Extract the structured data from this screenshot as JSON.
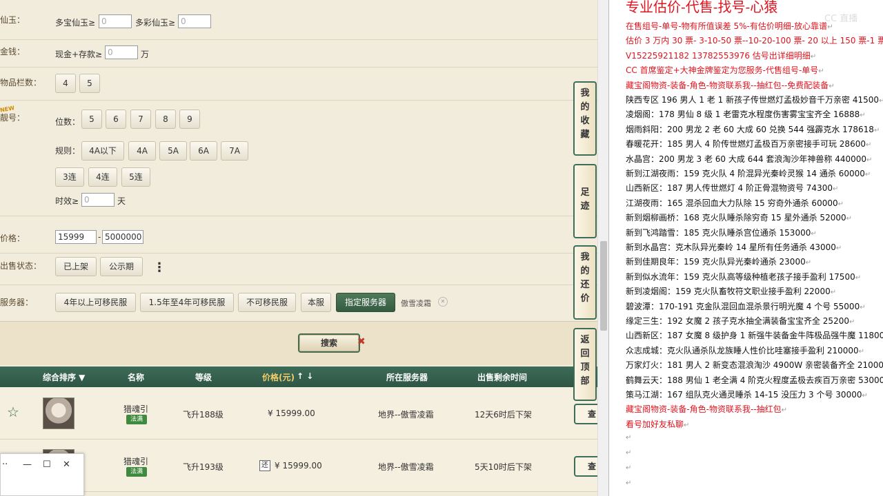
{
  "filters": {
    "jade": {
      "label": "仙玉：",
      "multi_label": "多宝仙玉≥",
      "multi_value": "0",
      "color_label": "多彩仙玉≥",
      "color_value": "0"
    },
    "gold": {
      "label": "金钱：",
      "cash_label": "现金+存款≥",
      "cash_value": "0",
      "unit": "万"
    },
    "slots": {
      "label": "物品栏数：",
      "options": [
        "4",
        "5"
      ]
    },
    "pretty_id": {
      "label": "靓号：",
      "new_badge": "NEW",
      "digits_label": "位数：",
      "digits": [
        "5",
        "6",
        "7",
        "8",
        "9"
      ],
      "rule_label": "规则：",
      "rules": [
        "4A以下",
        "4A",
        "5A",
        "6A",
        "7A"
      ],
      "sequence": [
        "3连",
        "4连",
        "5连"
      ],
      "validity_label": "时效≥",
      "validity_value": "0",
      "validity_unit": "天"
    },
    "price": {
      "label": "价格：",
      "min": "15999",
      "separator": "-",
      "max": "5000000"
    },
    "sale_status": {
      "label": "出售状态：",
      "options": [
        "已上架",
        "公示期"
      ],
      "more": "⋮"
    },
    "server": {
      "label": "服务器：",
      "options": [
        "4年以上可移民服",
        "1.5年至4年可移民服",
        "不可移民服",
        "本服",
        "指定服务器"
      ],
      "active": "指定服务器",
      "selected_server": "傲雪凌霜",
      "clear": "✕"
    }
  },
  "search": {
    "label": "搜索",
    "close": "✖"
  },
  "table": {
    "headers": {
      "sort": "综合排序 ▼",
      "name": "名称",
      "level": "等级",
      "price": "价格(元)",
      "price_arrows": "↑ ↓",
      "server": "所在服务器",
      "time": "出售剩余时间"
    },
    "rows": [
      {
        "star": "☆",
        "name": "猎魂引",
        "school": "法满",
        "level": "飞升188级",
        "return_badge": "",
        "price": "¥ 15999.00",
        "server": "地界--傲雪凌霜",
        "time": "12天6时后下架",
        "view": "查"
      },
      {
        "star": "☆",
        "name": "猎魂引",
        "school": "法满",
        "level": "飞升193级",
        "return_badge": "还",
        "price": "¥ 15999.00",
        "server": "地界--傲雪凌霜",
        "time": "5天10时后下架",
        "view": "查"
      }
    ]
  },
  "side_bar": {
    "favorites": "我的收藏",
    "history": "足迹",
    "bargain": "我的还价",
    "top": "返回顶部"
  },
  "mini_window": {
    "menu": "··",
    "minimize": "—",
    "maximize": "☐",
    "close": "✕"
  },
  "notes": {
    "title": "专业估价-代售-找号-心猿",
    "watermark": "CC 直播",
    "para_mark": "↵",
    "lines": [
      {
        "text": "在售组号-单号-物有所值误差 5%-有估价明细-放心靠谱",
        "color": "red"
      },
      {
        "text": "估价 3 万内 30 票- 3-10-50 票--10-20-100 票- 20 以上 150 票-1 票 1 元",
        "color": "red"
      },
      {
        "text": "V15225921182     13782553976    估号出详细明细",
        "color": "red"
      },
      {
        "text": "CC 首席鉴定+大神金牌鉴定为您服务-代售组号-单号",
        "color": "red"
      },
      {
        "text": "藏宝阁物资-装备-角色-物资联系我--抽红包--免费配装备",
        "color": "red"
      },
      {
        "text": "陕西专区 196 男人 1 老 1 新孩子传世燃灯孟极妙音千万亲密 41500",
        "color": "black"
      },
      {
        "text": "凌烟阁：178 男仙 8 级 1 老雷克水程度伤害雾宝宝齐全 16888",
        "color": "black"
      },
      {
        "text": "烟雨斜阳：200 男龙 2 老 60 大成 60 兑换 544 强霹克水 178618",
        "color": "black"
      },
      {
        "text": "春暖花开：185 男人 4 阶传世燃灯孟极百万亲密接手可玩 28600",
        "color": "black"
      },
      {
        "text": "水晶宫：200 男龙 3 老 60 大成 644 套浪淘沙年神兽称 440000",
        "color": "black"
      },
      {
        "text": "新到江湖夜雨：159 克火队 4 阶混异光秦岭灵猴 14 通杀 60000",
        "color": "black"
      },
      {
        "text": "山西新区：187 男人传世燃灯 4 阶正骨混物资号 74300",
        "color": "black"
      },
      {
        "text": "江湖夜雨：165 混杀回血大力队除 15 穷奇外通杀 60000",
        "color": "black"
      },
      {
        "text": "新到烟柳画桥：168 克火队睡杀除穷奇 15 星外通杀 52000",
        "color": "black"
      },
      {
        "text": "新到飞鸿踏雪：185 克火队睡杀宫位通杀 153000",
        "color": "black"
      },
      {
        "text": "新到水晶宫：克木队异光秦岭 14 星所有任务通杀 43000",
        "color": "black"
      },
      {
        "text": "新到佳期良年：159 克火队异光秦岭通杀 23000",
        "color": "black"
      },
      {
        "text": "新到似水流年：159 克火队高等级种植老孩子接手盈利 17500",
        "color": "black"
      },
      {
        "text": "新到凌烟阁：159 克火队畜牧符文职业接手盈利 22000",
        "color": "black"
      },
      {
        "text": "碧波潭：170-191 克金队混回血混杀景行明光魔 4 个号 55000",
        "color": "black"
      },
      {
        "text": "缘定三生：192 女魔 2 孩子克水抽全满装备宝宝齐全 25200",
        "color": "black"
      },
      {
        "text": "山西新区：187 女魔 8 级护身 1 新强牛装备金牛阵极品强牛魔 11800",
        "color": "black"
      },
      {
        "text": "众志成城：克火队通杀队龙族睡人性价比哇塞接手盈利 210000",
        "color": "black"
      },
      {
        "text": "万家灯火：181 男人 2 新变态混浪淘沙 4900W 亲密装备齐全 210000",
        "color": "black"
      },
      {
        "text": "鹤舞云天：188 男仙 1 老全满 4 阶克火程度孟极去疾百万亲密 53000",
        "color": "black"
      },
      {
        "text": "策马江湖：167 组队克火通灵睡杀 14-15 没压力 3 个号 30000",
        "color": "black"
      },
      {
        "text": "藏宝阁物资-装备-角色-物资联系我--抽红包",
        "color": "red"
      },
      {
        "text": "看号加好友私聊",
        "color": "red"
      }
    ]
  },
  "colors": {
    "accent_green": "#3d6c57",
    "note_red": "#e0141e",
    "page_bg": "#f2ecdc"
  }
}
